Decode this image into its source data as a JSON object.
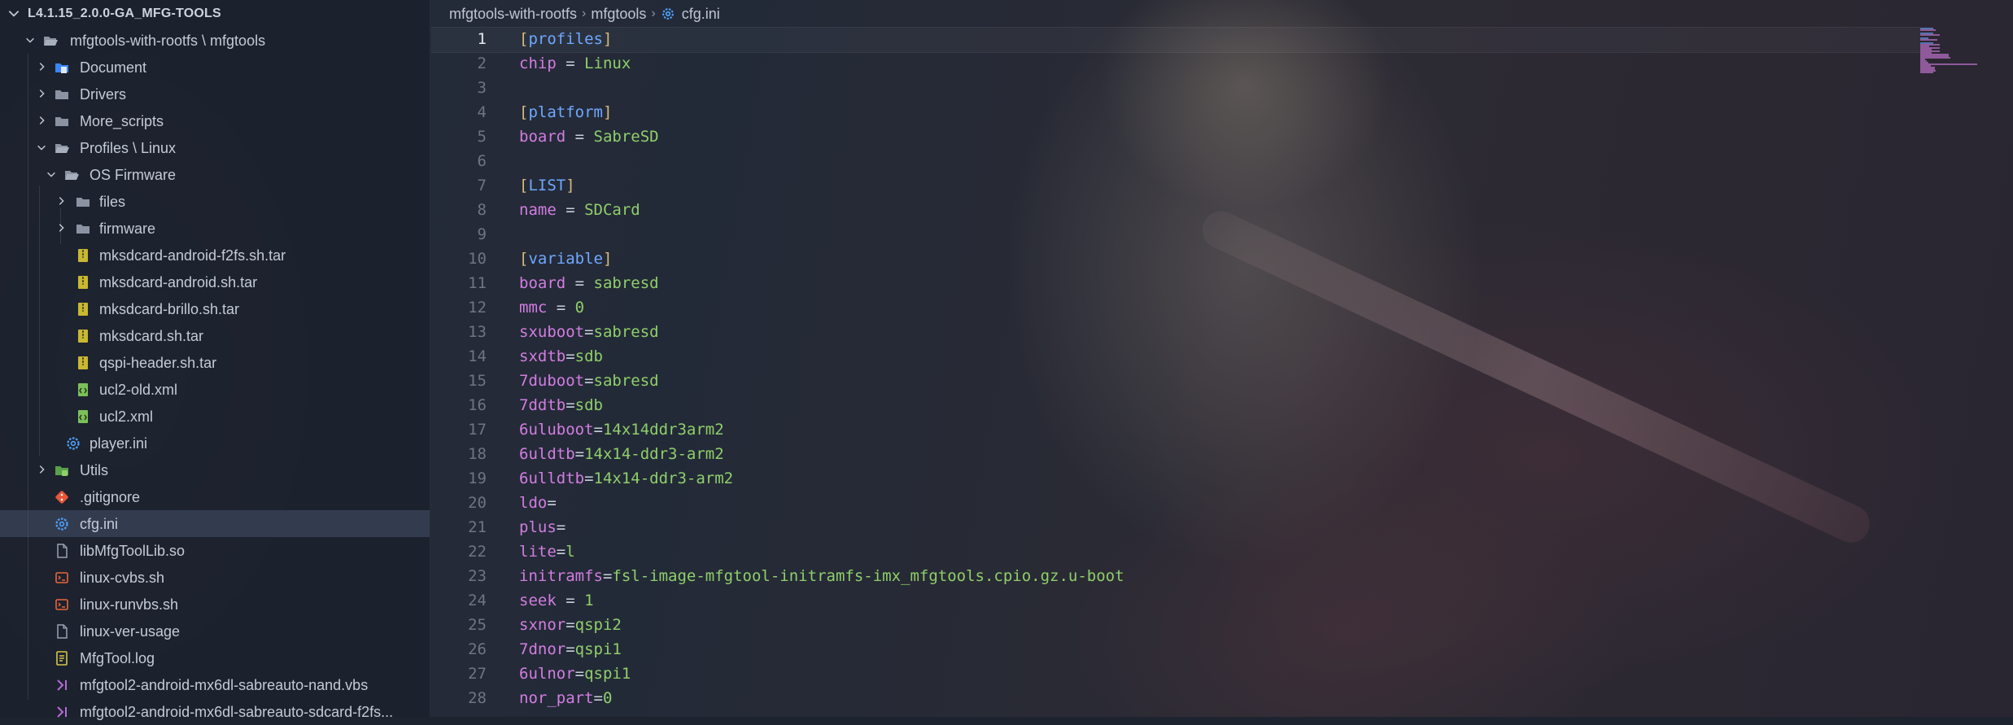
{
  "explorer": {
    "root_title": "L4.1.15_2.0.0-GA_MFG-TOOLS",
    "items": [
      {
        "label": "mfgtools-with-rootfs \\ mfgtools",
        "icon": "folder-open-icon",
        "type": "folder-open"
      },
      {
        "label": "Document",
        "icon": "document-folder-icon",
        "type": "folder"
      },
      {
        "label": "Drivers",
        "icon": "folder-icon",
        "type": "folder"
      },
      {
        "label": "More_scripts",
        "icon": "folder-icon",
        "type": "folder"
      },
      {
        "label": "Profiles \\ Linux",
        "icon": "folder-open-icon",
        "type": "folder-open"
      },
      {
        "label": "OS Firmware",
        "icon": "folder-open-icon",
        "type": "folder-open"
      },
      {
        "label": "files",
        "icon": "folder-icon",
        "type": "folder"
      },
      {
        "label": "firmware",
        "icon": "folder-icon",
        "type": "folder"
      },
      {
        "label": "mksdcard-android-f2fs.sh.tar",
        "icon": "archive-icon",
        "type": "file"
      },
      {
        "label": "mksdcard-android.sh.tar",
        "icon": "archive-icon",
        "type": "file"
      },
      {
        "label": "mksdcard-brillo.sh.tar",
        "icon": "archive-icon",
        "type": "file"
      },
      {
        "label": "mksdcard.sh.tar",
        "icon": "archive-icon",
        "type": "file"
      },
      {
        "label": "qspi-header.sh.tar",
        "icon": "archive-icon",
        "type": "file"
      },
      {
        "label": "ucl2-old.xml",
        "icon": "xml-file-icon",
        "type": "file"
      },
      {
        "label": "ucl2.xml",
        "icon": "xml-file-icon",
        "type": "file"
      },
      {
        "label": "player.ini",
        "icon": "settings-file-icon",
        "type": "file"
      },
      {
        "label": "Utils",
        "icon": "utils-folder-icon",
        "type": "folder"
      },
      {
        "label": ".gitignore",
        "icon": "git-icon",
        "type": "file"
      },
      {
        "label": "cfg.ini",
        "icon": "settings-file-icon",
        "type": "file",
        "selected": true
      },
      {
        "label": "libMfgToolLib.so",
        "icon": "file-icon",
        "type": "file"
      },
      {
        "label": "linux-cvbs.sh",
        "icon": "shell-script-icon",
        "type": "file"
      },
      {
        "label": "linux-runvbs.sh",
        "icon": "shell-script-icon",
        "type": "file"
      },
      {
        "label": "linux-ver-usage",
        "icon": "file-icon",
        "type": "file"
      },
      {
        "label": "MfgTool.log",
        "icon": "log-file-icon",
        "type": "file"
      },
      {
        "label": "mfgtool2-android-mx6dl-sabreauto-nand.vbs",
        "icon": "vbs-file-icon",
        "type": "file"
      },
      {
        "label": "mfgtool2-android-mx6dl-sabreauto-sdcard-f2fs...",
        "icon": "vbs-file-icon",
        "type": "file"
      }
    ]
  },
  "breadcrumb": {
    "parts": [
      "mfgtools-with-rootfs",
      "mfgtools",
      "cfg.ini"
    ]
  },
  "editor": {
    "active_line": 1,
    "lines": [
      {
        "n": "1",
        "kind": "section",
        "name": "profiles"
      },
      {
        "n": "2",
        "kind": "kv",
        "key": "chip",
        "sep": " = ",
        "value": "Linux"
      },
      {
        "n": "3",
        "kind": "blank"
      },
      {
        "n": "4",
        "kind": "section",
        "name": "platform"
      },
      {
        "n": "5",
        "kind": "kv",
        "key": "board",
        "sep": " = ",
        "value": "SabreSD"
      },
      {
        "n": "6",
        "kind": "blank"
      },
      {
        "n": "7",
        "kind": "section",
        "name": "LIST"
      },
      {
        "n": "8",
        "kind": "kv",
        "key": "name",
        "sep": " = ",
        "value": "SDCard"
      },
      {
        "n": "9",
        "kind": "blank"
      },
      {
        "n": "10",
        "kind": "section",
        "name": "variable"
      },
      {
        "n": "11",
        "kind": "kv",
        "key": "board",
        "sep": " = ",
        "value": "sabresd"
      },
      {
        "n": "12",
        "kind": "kv",
        "key": "mmc",
        "sep": " = ",
        "value": "0"
      },
      {
        "n": "13",
        "kind": "kv",
        "key": "sxuboot",
        "sep": "=",
        "value": "sabresd"
      },
      {
        "n": "14",
        "kind": "kv",
        "key": "sxdtb",
        "sep": "=",
        "value": "sdb"
      },
      {
        "n": "15",
        "kind": "kv",
        "key": "7duboot",
        "sep": "=",
        "value": "sabresd"
      },
      {
        "n": "16",
        "kind": "kv",
        "key": "7ddtb",
        "sep": "=",
        "value": "sdb"
      },
      {
        "n": "17",
        "kind": "kv",
        "key": "6uluboot",
        "sep": "=",
        "value": "14x14ddr3arm2"
      },
      {
        "n": "18",
        "kind": "kv",
        "key": "6uldtb",
        "sep": "=",
        "value": "14x14-ddr3-arm2"
      },
      {
        "n": "19",
        "kind": "kv",
        "key": "6ulldtb",
        "sep": "=",
        "value": "14x14-ddr3-arm2"
      },
      {
        "n": "20",
        "kind": "kv",
        "key": "ldo",
        "sep": "=",
        "value": ""
      },
      {
        "n": "21",
        "kind": "kv",
        "key": "plus",
        "sep": "=",
        "value": ""
      },
      {
        "n": "22",
        "kind": "kv",
        "key": "lite",
        "sep": "=",
        "value": "l"
      },
      {
        "n": "23",
        "kind": "kv",
        "key": "initramfs",
        "sep": "=",
        "value": "fsl-image-mfgtool-initramfs-imx_mfgtools.cpio.gz.u-boot"
      },
      {
        "n": "24",
        "kind": "kv",
        "key": "seek",
        "sep": " = ",
        "value": "1"
      },
      {
        "n": "25",
        "kind": "kv",
        "key": "sxnor",
        "sep": "=",
        "value": "qspi2"
      },
      {
        "n": "26",
        "kind": "kv",
        "key": "7dnor",
        "sep": "=",
        "value": "qspi1"
      },
      {
        "n": "27",
        "kind": "kv",
        "key": "6ulnor",
        "sep": "=",
        "value": "qspi1"
      },
      {
        "n": "28",
        "kind": "kv",
        "key": "nor_part",
        "sep": "=",
        "value": "0"
      }
    ]
  },
  "colors": {
    "bracket": "#d7ba7d",
    "section": "#6fa8ff",
    "key": "#d27de0",
    "value": "#8fcf6a"
  }
}
